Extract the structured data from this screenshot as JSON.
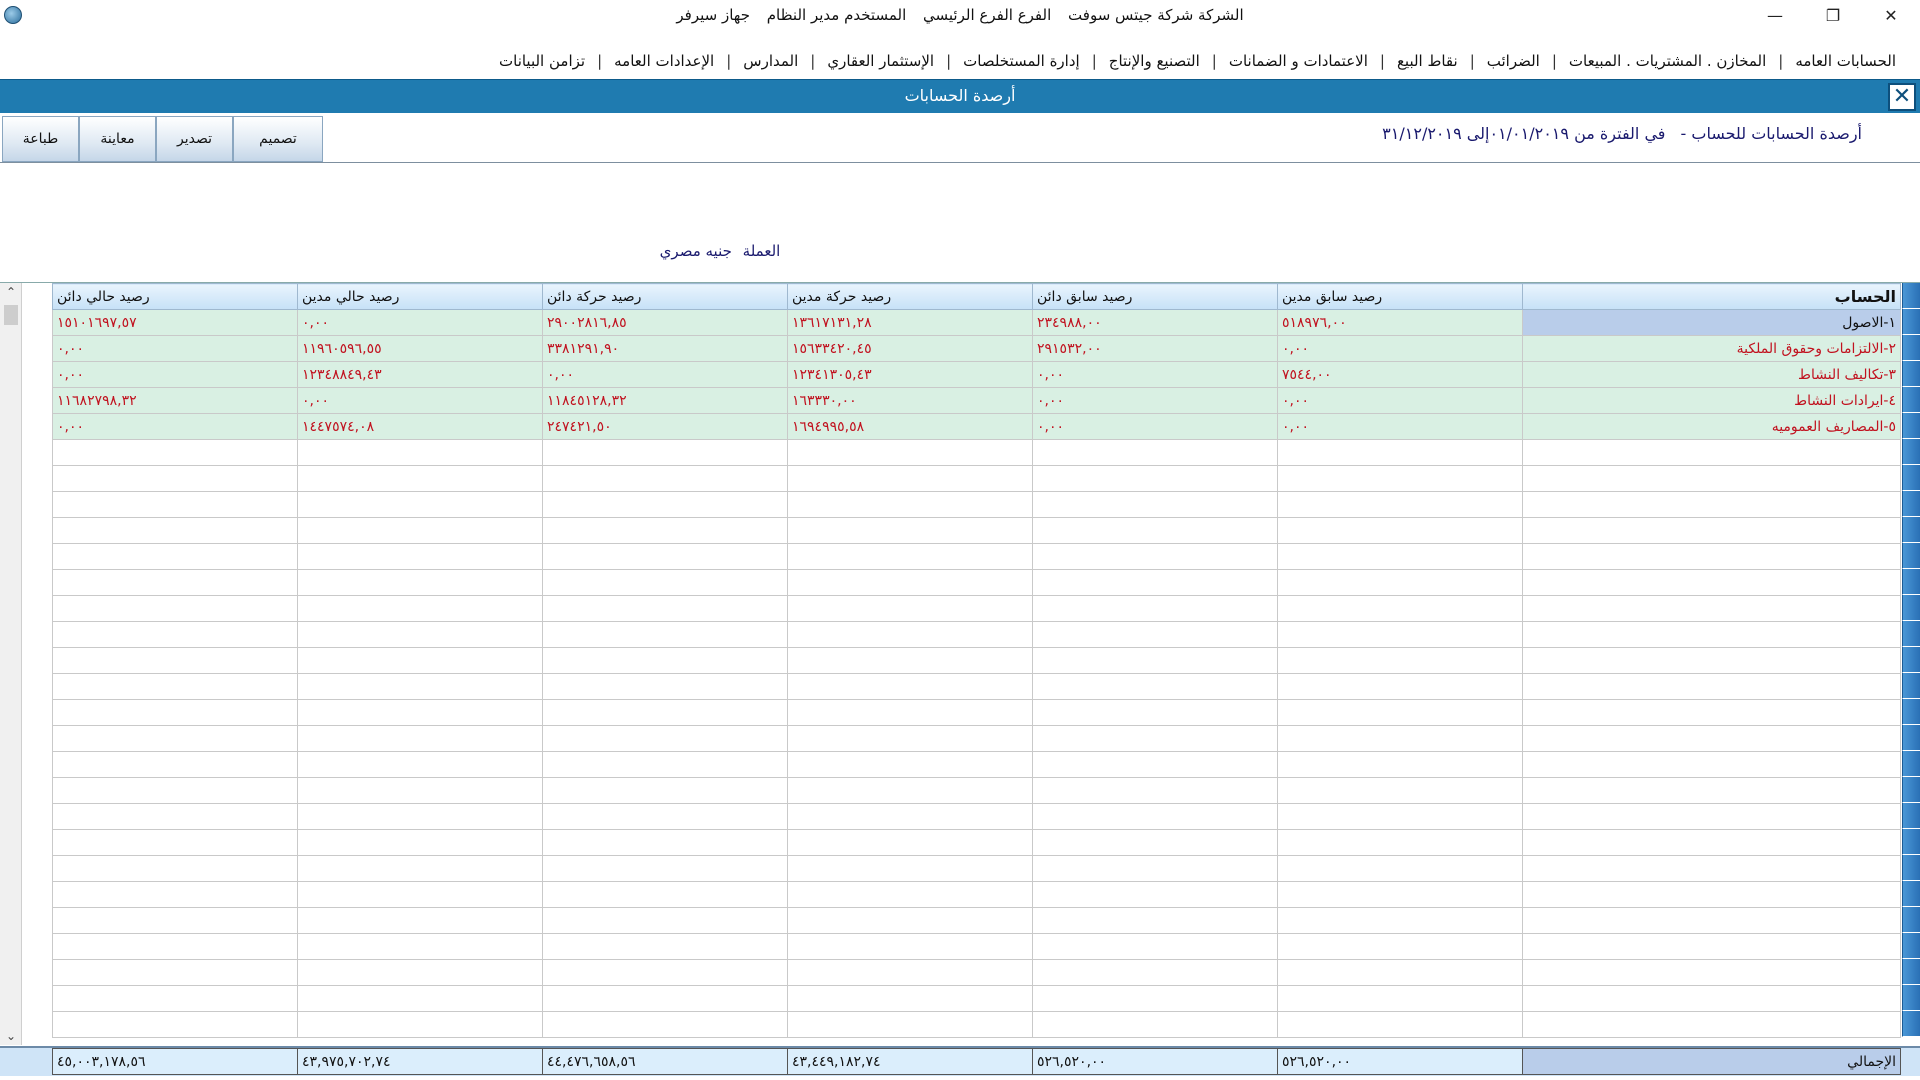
{
  "titlebar": {
    "company": "الشركة شركة جيتس سوفت",
    "branch": "الفرع الفرع الرئيسي",
    "user": "المستخدم مدير النظام",
    "device": "جهاز سيرفر",
    "minimize": "—",
    "restore": "❐",
    "close": "✕"
  },
  "menu": [
    "الحسابات العامه",
    "المخازن . المشتريات . المبيعات",
    "الضرائب",
    "نقاط البيع",
    "الاعتمادات و الضمانات",
    "التصنيع والإنتاج",
    "إدارة المستخلصات",
    "الإستثمار العقاري",
    "المدارس",
    "الإعدادات العامه",
    "تزامن البيانات"
  ],
  "window": {
    "title": "أرصدة الحسابات",
    "close_label": "✕"
  },
  "toolbar": {
    "print": "طباعة",
    "preview": "معاينة",
    "export": "تصدير",
    "design": "تصميم"
  },
  "report": {
    "title": "أرصدة الحسابات للحساب -",
    "period": "في الفترة من ٠١/٠١/٢٠١٩إلى ٣١/١٢/٢٠١٩"
  },
  "currency": {
    "label": "العملة",
    "value": "جنيه مصري"
  },
  "grid": {
    "headers": [
      "الحساب",
      "رصيد سابق مدين",
      "رصيد سابق دائن",
      "رصيد حركة مدين",
      "رصيد حركة دائن",
      "رصيد حالي مدين",
      "رصيد حالي دائن"
    ],
    "rows": [
      [
        "١-الاصول",
        "٥١٨٩٧٦,٠٠",
        "٢٣٤٩٨٨,٠٠",
        "١٣٦١٧١٣١,٢٨",
        "٢٩٠٠٢٨١٦,٨٥",
        "٠,٠٠",
        "١٥١٠١٦٩٧,٥٧"
      ],
      [
        "٢-الالتزامات وحقوق الملكية",
        "٠,٠٠",
        "٢٩١٥٣٢,٠٠",
        "١٥٦٣٣٤٢٠,٤٥",
        "٣٣٨١٢٩١,٩٠",
        "١١٩٦٠٥٩٦,٥٥",
        "٠,٠٠"
      ],
      [
        "٣-تكاليف النشاط",
        "٧٥٤٤,٠٠",
        "٠,٠٠",
        "١٢٣٤١٣٠٥,٤٣",
        "٠,٠٠",
        "١٢٣٤٨٨٤٩,٤٣",
        "٠,٠٠"
      ],
      [
        "٤-ايرادات النشاط",
        "٠,٠٠",
        "٠,٠٠",
        "١٦٣٣٣٠,٠٠",
        "١١٨٤٥١٢٨,٣٢",
        "٠,٠٠",
        "١١٦٨٢٧٩٨,٣٢"
      ],
      [
        "٥-المصاريف العموميه",
        "٠,٠٠",
        "٠,٠٠",
        "١٦٩٤٩٩٥,٥٨",
        "٢٤٧٤٢١,٥٠",
        "١٤٤٧٥٧٤,٠٨",
        "٠,٠٠"
      ]
    ],
    "totals": [
      "الإجمالي",
      "٥٢٦,٥٢٠,٠٠",
      "٥٢٦,٥٢٠,٠٠",
      "٤٣,٤٤٩,١٨٢,٧٤",
      "٤٤,٤٧٦,٦٥٨,٥٦",
      "٤٣,٩٧٥,٧٠٢,٧٤",
      "٤٥,٠٠٣,١٧٨,٥٦"
    ]
  },
  "colors": {
    "header_blue": "#1f7bb0",
    "row_green": "#d9f0e3",
    "value_red": "#c1121f",
    "selected_blue": "#b9cdea"
  }
}
